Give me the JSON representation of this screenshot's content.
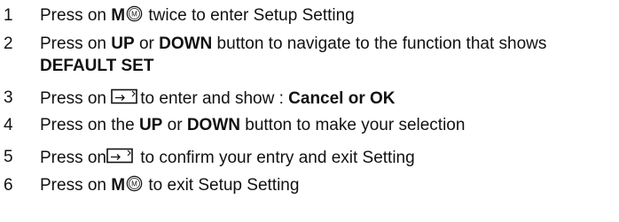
{
  "steps": [
    {
      "number": "1",
      "parts": {
        "a": "Press on ",
        "b_bold": "M",
        "c": " twice to enter Setup Setting"
      },
      "icons": [
        "m-button-icon"
      ]
    },
    {
      "number": "2",
      "parts": {
        "a": "Press on ",
        "b_bold": "UP",
        "c": " or ",
        "d_bold": "DOWN",
        "e": " button to navigate to the function that shows",
        "f_bold": "DEFAULT SET"
      }
    },
    {
      "number": "3",
      "parts": {
        "a": "Press on ",
        "b": "to enter and show : ",
        "c_bold": "Cancel or OK"
      },
      "icons": [
        "enter-button-icon"
      ]
    },
    {
      "number": "4",
      "parts": {
        "a": "Press on the ",
        "b_bold": "UP",
        "c": " or ",
        "d_bold": "DOWN",
        "e": " button to make your selection"
      }
    },
    {
      "number": "5",
      "parts": {
        "a": "Press on",
        "b": " to confirm your entry and exit Setting"
      },
      "icons": [
        "enter-button-icon"
      ]
    },
    {
      "number": "6",
      "parts": {
        "a": "Press on ",
        "b_bold": "M",
        "c": " to exit Setup Setting"
      },
      "icons": [
        "m-button-icon"
      ]
    }
  ],
  "icon_labels": {
    "m_button": "M"
  }
}
